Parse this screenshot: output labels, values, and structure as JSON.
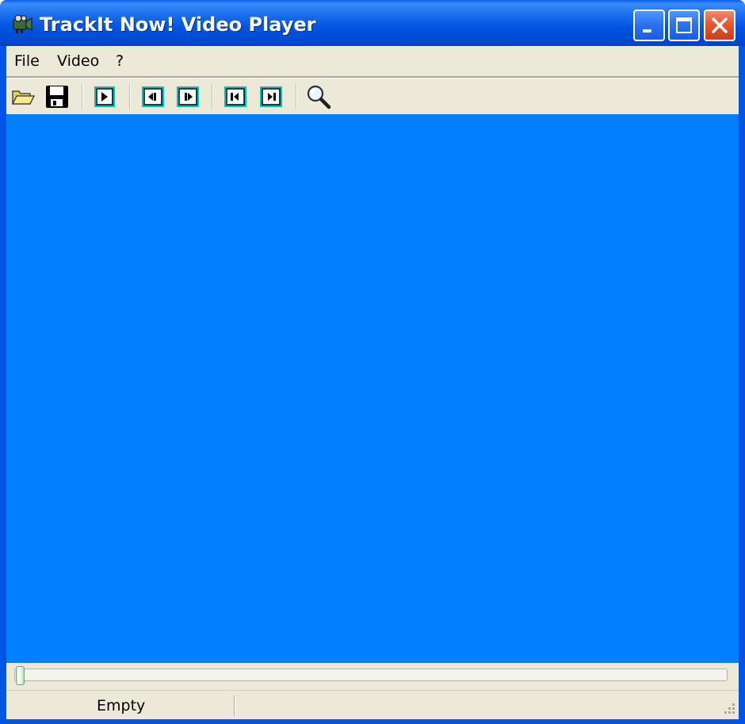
{
  "window": {
    "title": "TrackIt Now! Video Player",
    "app_icon": "camera-icon",
    "controls": {
      "minimize_icon": "minimize-icon",
      "maximize_icon": "maximize-icon",
      "close_icon": "close-icon"
    }
  },
  "menubar": {
    "items": [
      {
        "label": "File"
      },
      {
        "label": "Video"
      },
      {
        "label": "?"
      }
    ]
  },
  "toolbar": {
    "tools": [
      {
        "icon": "open-folder-icon"
      },
      {
        "icon": "save-icon"
      },
      {
        "icon": "play-icon"
      },
      {
        "icon": "step-back-icon"
      },
      {
        "icon": "step-forward-icon"
      },
      {
        "icon": "skip-to-start-icon"
      },
      {
        "icon": "skip-to-end-icon"
      },
      {
        "icon": "zoom-icon"
      }
    ]
  },
  "video": {
    "background_color": "#0080ff"
  },
  "seek": {
    "position": 0
  },
  "statusbar": {
    "status": "Empty"
  },
  "colors": {
    "titlebar": "#0054e3",
    "chrome": "#ece9d8",
    "tool_accent": "#00c0c0",
    "close_button": "#e0552e"
  }
}
